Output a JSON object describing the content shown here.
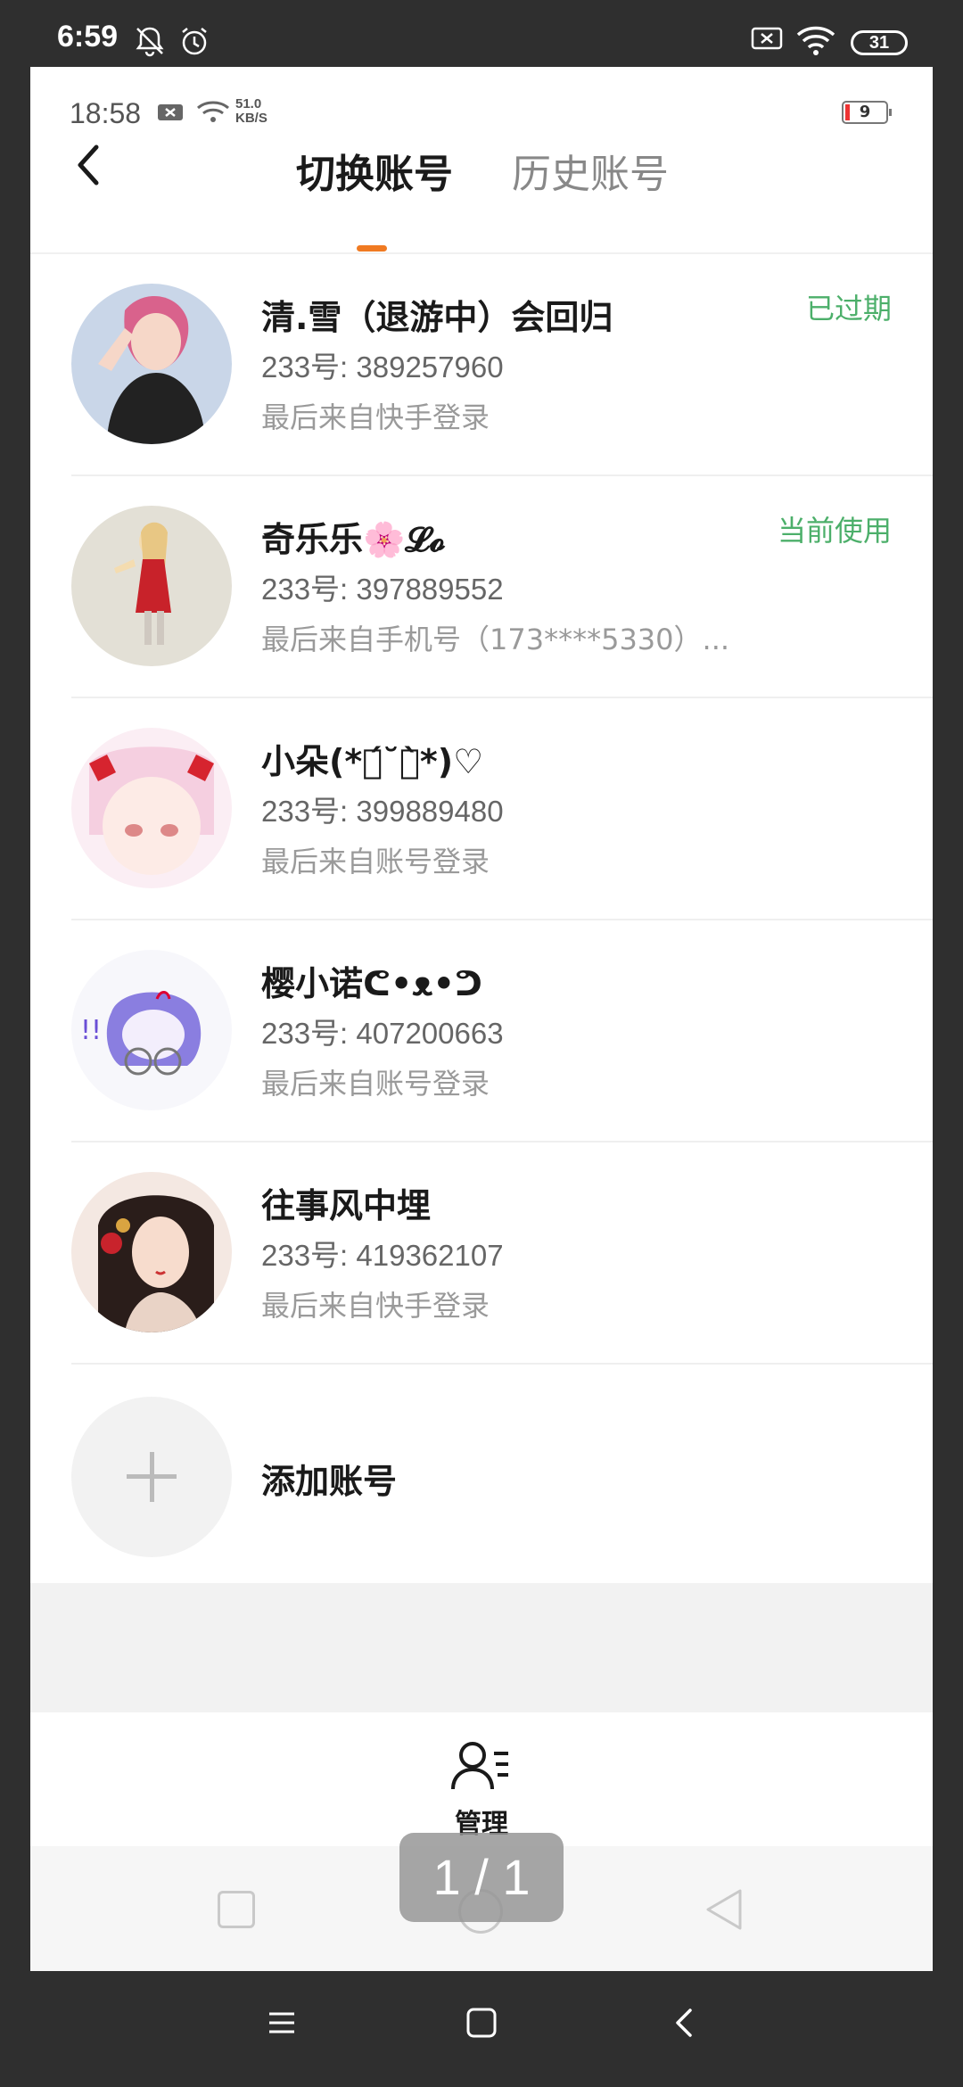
{
  "outer_status": {
    "time": "6:59",
    "battery": "31"
  },
  "inner_status": {
    "time": "18:58",
    "speed_value": "51.0",
    "speed_unit": "KB/S",
    "battery": "9"
  },
  "header": {
    "tabs": [
      {
        "label": "切换账号",
        "active": true
      },
      {
        "label": "历史账号",
        "active": false
      }
    ]
  },
  "accounts": [
    {
      "name": "清.雪（退游中）会回归",
      "id": "233号: 389257960",
      "from": "最后来自快手登录",
      "status": "已过期"
    },
    {
      "name": "奇乐乐🌸𝓛𝓸",
      "id": "233号: 397889552",
      "from": "最后来自手机号（173****5330）...",
      "status": "当前使用"
    },
    {
      "name": "小朵(*ฅ́˘ฅ̀*)♡",
      "id": "233号: 399889480",
      "from": "最后来自账号登录",
      "status": ""
    },
    {
      "name": "樱小诺ᕦ•ᴥ•ᕤ",
      "id": "233号: 407200663",
      "from": "最后来自账号登录",
      "status": ""
    },
    {
      "name": "往事风中埋",
      "id": "233号: 419362107",
      "from": "最后来自快手登录",
      "status": ""
    }
  ],
  "add_account": {
    "label": "添加账号"
  },
  "bottom": {
    "manage_label": "管理"
  },
  "page_indicator": "1 / 1",
  "colors": {
    "accent": "#f07a22",
    "status_green": "#4caf6a"
  }
}
